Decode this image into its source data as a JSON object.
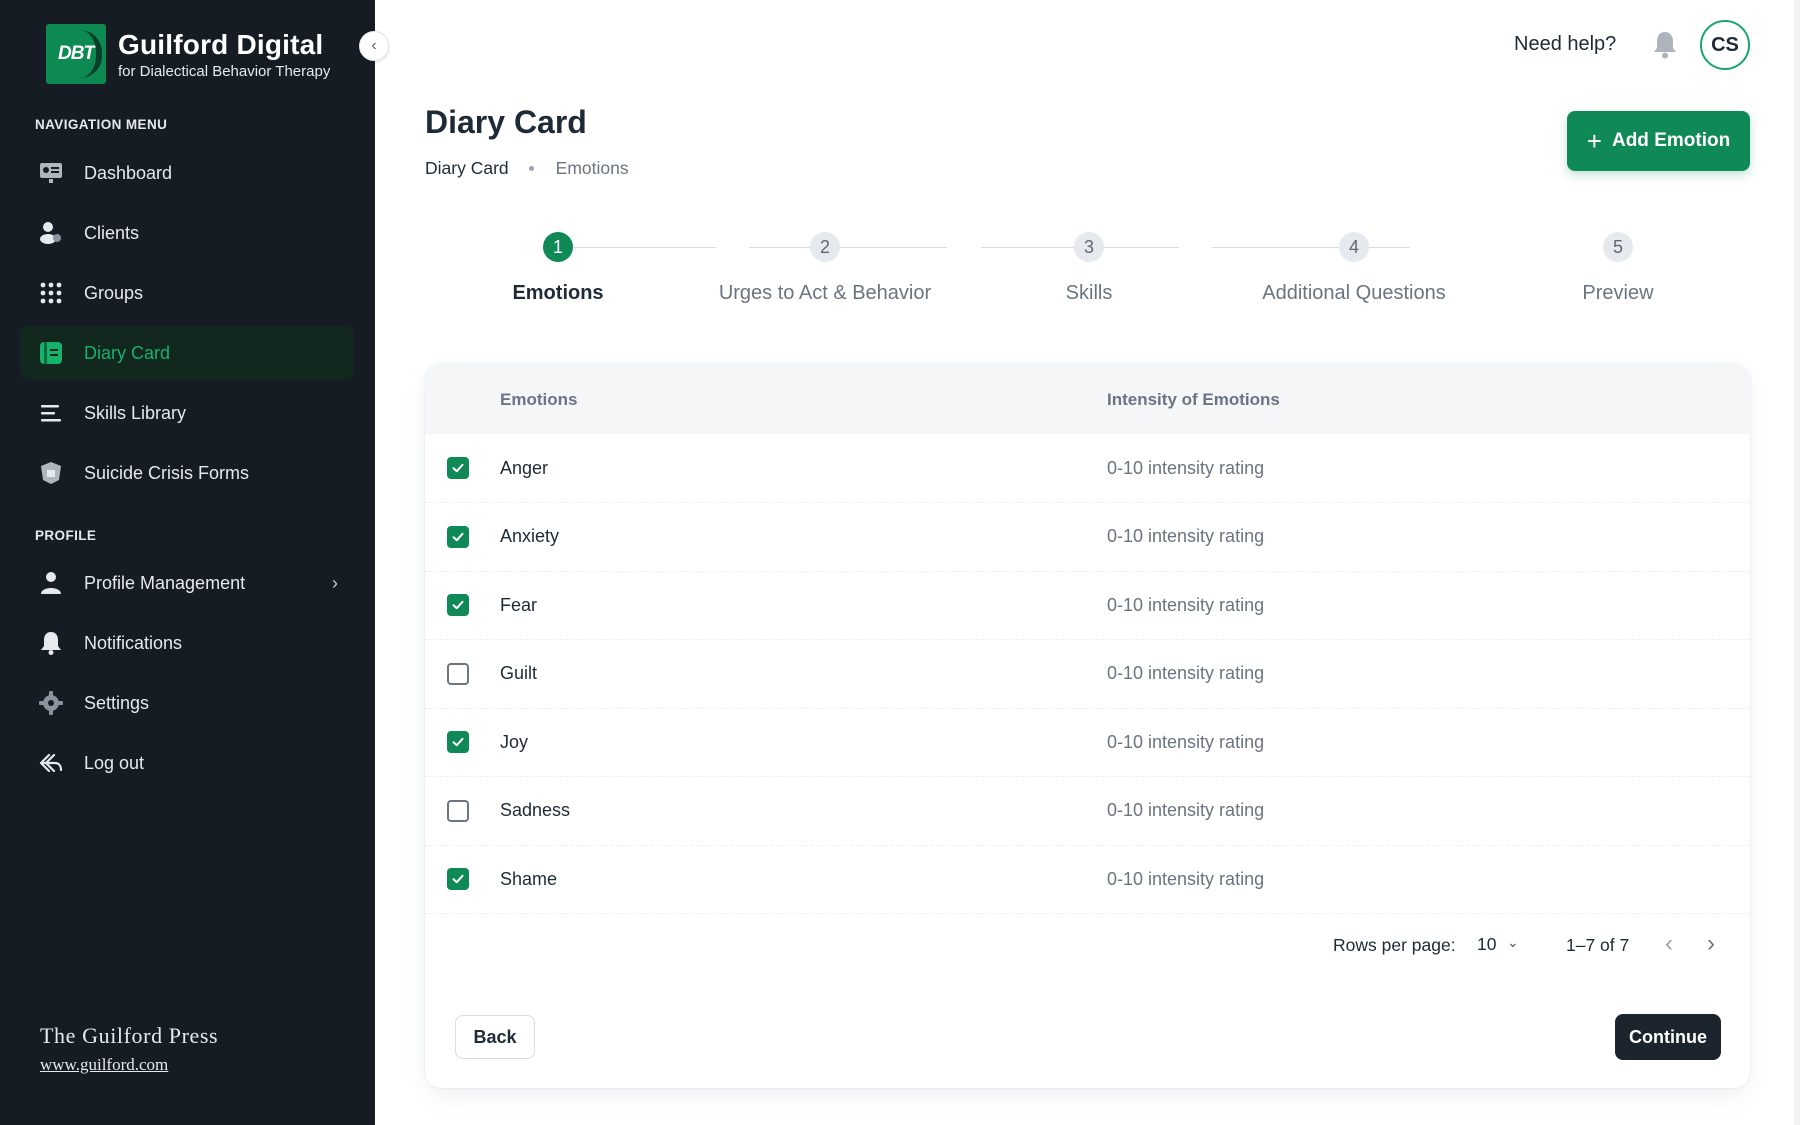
{
  "brand": {
    "logo_text": "DBT",
    "title": "Guilford Digital",
    "subtitle": "for Dialectical Behavior Therapy"
  },
  "sidebar": {
    "section_nav": "NAVIGATION MENU",
    "nav_items": [
      {
        "label": "Dashboard",
        "icon": "dashboard-icon"
      },
      {
        "label": "Clients",
        "icon": "clients-icon"
      },
      {
        "label": "Groups",
        "icon": "grid-icon"
      },
      {
        "label": "Diary Card",
        "icon": "diary-card-icon",
        "active": true
      },
      {
        "label": "Skills Library",
        "icon": "list-icon"
      },
      {
        "label": "Suicide Crisis Forms",
        "icon": "crisis-form-icon"
      }
    ],
    "section_profile": "PROFILE",
    "profile_items": [
      {
        "label": "Profile Management",
        "icon": "user-icon",
        "has_chevron": true
      },
      {
        "label": "Notifications",
        "icon": "bell-icon"
      },
      {
        "label": "Settings",
        "icon": "gear-icon"
      },
      {
        "label": "Log out",
        "icon": "logout-icon"
      }
    ],
    "footer_title": "The Guilford Press",
    "footer_link": "www.guilford.com"
  },
  "header": {
    "help": "Need help?",
    "avatar_initials": "CS"
  },
  "page": {
    "title": "Diary Card",
    "breadcrumb": [
      "Diary Card",
      "Emotions"
    ],
    "add_button": "Add Emotion"
  },
  "stepper": {
    "steps": [
      {
        "num": "1",
        "label": "Emotions",
        "active": true
      },
      {
        "num": "2",
        "label": "Urges to Act & Behavior"
      },
      {
        "num": "3",
        "label": "Skills"
      },
      {
        "num": "4",
        "label": "Additional Questions"
      },
      {
        "num": "5",
        "label": "Preview"
      }
    ]
  },
  "table": {
    "headers": [
      "Emotions",
      "Intensity of Emotions"
    ],
    "rows": [
      {
        "emotion": "Anger",
        "intensity": "0-10 intensity rating",
        "checked": true
      },
      {
        "emotion": "Anxiety",
        "intensity": "0-10 intensity rating",
        "checked": true
      },
      {
        "emotion": "Fear",
        "intensity": "0-10 intensity rating",
        "checked": true
      },
      {
        "emotion": "Guilt",
        "intensity": "0-10 intensity rating",
        "checked": false
      },
      {
        "emotion": "Joy",
        "intensity": "0-10 intensity rating",
        "checked": true
      },
      {
        "emotion": "Sadness",
        "intensity": "0-10 intensity rating",
        "checked": false
      },
      {
        "emotion": "Shame",
        "intensity": "0-10 intensity rating",
        "checked": true
      }
    ]
  },
  "pagination": {
    "rows_per_page_label": "Rows per page:",
    "rows_per_page": "10",
    "range": "1–7 of 7"
  },
  "actions": {
    "back": "Back",
    "continue": "Continue"
  },
  "colors": {
    "accent": "#0f8a56",
    "sidebar_bg": "#161c24",
    "dark_button": "#1c252e"
  }
}
